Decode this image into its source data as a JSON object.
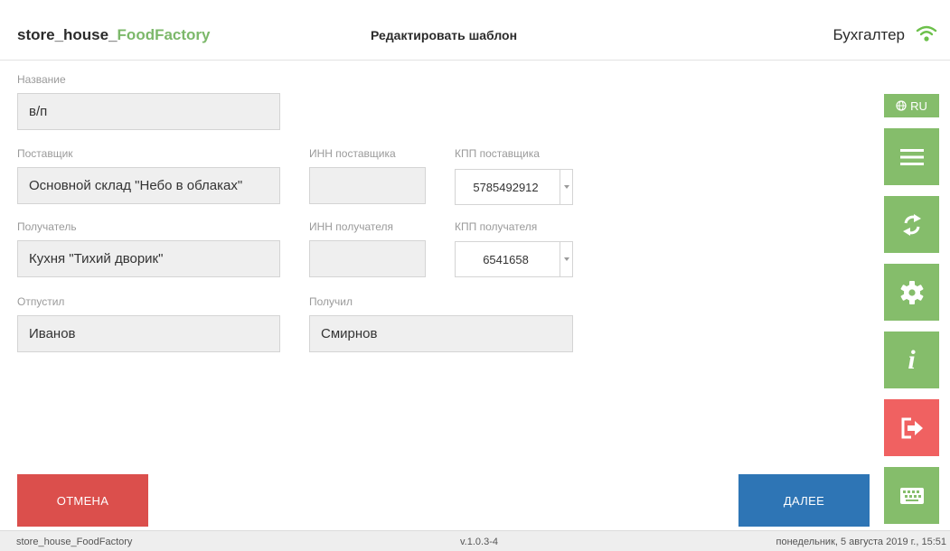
{
  "header": {
    "brand_prefix": "store_house_",
    "brand_accent": "FoodFactory",
    "title": "Редактировать шаблон",
    "role": "Бухгалтер",
    "wifi_icon": "wifi-icon"
  },
  "form": {
    "name": {
      "label": "Название",
      "value": "в/п"
    },
    "supplier": {
      "label": "Поставщик",
      "value": "Основной склад \"Небо в облаках\""
    },
    "supplier_inn": {
      "label": "ИНН поставщика",
      "value": ""
    },
    "supplier_kpp": {
      "label": "КПП поставщика",
      "value": "5785492912"
    },
    "recipient": {
      "label": "Получатель",
      "value": "Кухня \"Тихий дворик\""
    },
    "recipient_inn": {
      "label": "ИНН получателя",
      "value": ""
    },
    "recipient_kpp": {
      "label": "КПП получателя",
      "value": "6541658"
    },
    "released_by": {
      "label": "Отпустил",
      "value": "Иванов"
    },
    "received_by": {
      "label": "Получил",
      "value": "Смирнов"
    }
  },
  "sidebar": {
    "lang_label": "RU",
    "lang_icon": "globe-icon",
    "buttons": [
      {
        "icon": "menu-icon"
      },
      {
        "icon": "sync-icon"
      },
      {
        "icon": "gear-icon"
      },
      {
        "icon": "info-icon"
      },
      {
        "icon": "logout-icon"
      },
      {
        "icon": "keyboard-icon"
      }
    ]
  },
  "actions": {
    "cancel_label": "ОТМЕНА",
    "next_label": "ДАЛЕЕ"
  },
  "footer": {
    "app_name": "store_house_FoodFactory",
    "version": "v.1.0.3-4",
    "datetime": "понедельник, 5 августа 2019 г., 15:51"
  },
  "colors": {
    "green": "#85bd6b",
    "red": "#db4f4c",
    "blue": "#2e75b5",
    "brand_accent": "#7cb86a"
  }
}
